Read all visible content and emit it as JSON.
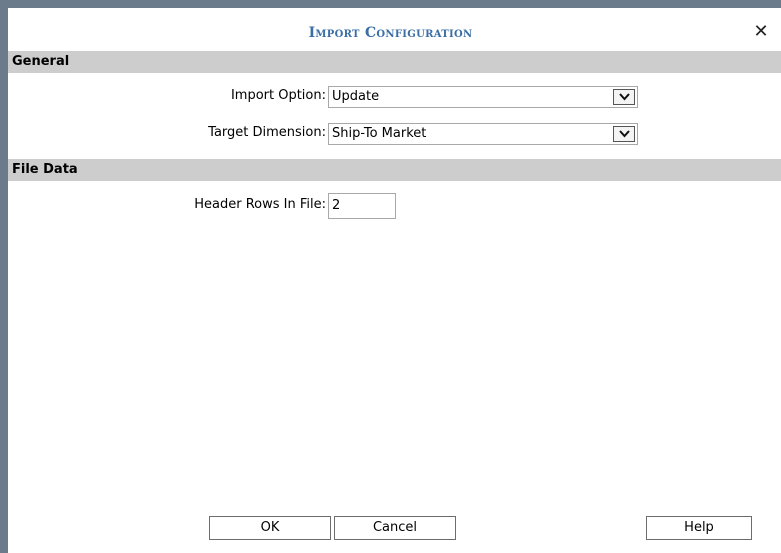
{
  "dialog": {
    "title": "Import Configuration",
    "close_symbol": "✕"
  },
  "sections": {
    "general": {
      "label": "General",
      "import_option": {
        "label": "Import Option:",
        "value": "Update"
      },
      "target_dimension": {
        "label": "Target Dimension:",
        "value": "Ship-To Market"
      }
    },
    "file_data": {
      "label": "File Data",
      "header_rows": {
        "label": "Header Rows In File:",
        "value": "2"
      }
    }
  },
  "buttons": {
    "ok": "OK",
    "cancel": "Cancel",
    "help": "Help"
  },
  "icons": {
    "close": "close-icon",
    "dropdown": "chevron-down-icon"
  },
  "colors": {
    "title": "#3b6ea5",
    "section_header_bg": "#cdcdcd",
    "outer_frame": "#6b7b8c"
  }
}
